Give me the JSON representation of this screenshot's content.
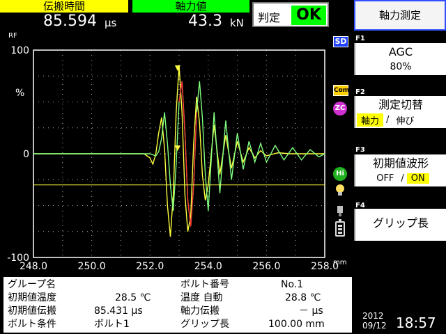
{
  "header": {
    "time_label": "伝搬時間",
    "time_value": "85.594",
    "time_unit": "μs",
    "force_label": "軸力値",
    "force_value": "43.3",
    "force_unit": "kN",
    "judge_label": "判定",
    "judge_value": "OK"
  },
  "chart_data": {
    "type": "line",
    "ylabel": "RF",
    "y_unit": "%",
    "x_unit": "mm",
    "xlim": [
      248.0,
      258.0
    ],
    "ylim": [
      -100,
      100
    ],
    "x_ticks": [
      "248.0",
      "250.0",
      "252.0",
      "254.0",
      "256.0",
      "258.0"
    ],
    "y_ticks": [
      "100",
      "0",
      "-100"
    ],
    "gate_level": -30,
    "marker_x": 252.95,
    "grid": true,
    "colors": {
      "wave_initial": "#ffff40",
      "wave_current": "#80ff80",
      "wave_peak": "#ff3030",
      "gate": "#ffff40",
      "grid": "#b0b0b0"
    },
    "series": [
      {
        "key": "initial",
        "x": [
          248.0,
          251.8,
          252.0,
          252.1,
          252.2,
          252.3,
          252.4,
          252.5,
          252.6,
          252.7,
          252.8,
          252.9,
          253.0,
          253.1,
          253.2,
          253.3,
          253.4,
          253.5,
          253.6,
          253.7,
          253.8,
          253.9,
          254.0,
          254.2,
          254.4,
          254.6,
          254.8,
          255.0,
          255.2,
          255.4,
          255.6,
          255.8,
          256.0,
          256.4,
          256.8,
          257.2,
          257.6,
          258.0
        ],
        "y": [
          0,
          0,
          -4,
          -10,
          0,
          20,
          35,
          5,
          -50,
          -80,
          -40,
          40,
          85,
          40,
          -40,
          -75,
          -60,
          10,
          55,
          30,
          -20,
          -45,
          -30,
          28,
          -20,
          18,
          -14,
          12,
          -8,
          6,
          -4,
          3,
          -2,
          1,
          0,
          0,
          0,
          0
        ]
      },
      {
        "key": "current",
        "x": [
          248.0,
          252.0,
          252.2,
          252.3,
          252.4,
          252.5,
          252.6,
          252.7,
          252.8,
          252.9,
          253.0,
          253.1,
          253.2,
          253.3,
          253.4,
          253.5,
          253.6,
          253.7,
          253.8,
          253.9,
          254.0,
          254.2,
          254.4,
          254.6,
          254.8,
          255.0,
          255.2,
          255.4,
          255.6,
          255.8,
          256.0,
          256.3,
          256.6,
          256.9,
          257.2,
          257.5,
          257.8,
          258.0
        ],
        "y": [
          0,
          0,
          -2,
          2,
          15,
          40,
          10,
          -30,
          -55,
          -10,
          50,
          70,
          20,
          -45,
          -70,
          -30,
          40,
          70,
          35,
          -20,
          -55,
          40,
          -38,
          32,
          -25,
          20,
          -15,
          12,
          -8,
          10,
          -8,
          8,
          -6,
          6,
          -6,
          4,
          -3,
          0
        ]
      }
    ]
  },
  "icons": {
    "sd": "SD",
    "com": "Com",
    "zc": "ZC",
    "hi": "Hi",
    "bulb": "bulb-icon",
    "probe": "probe-icon",
    "battery": "battery-icon"
  },
  "fkeys": {
    "title": "軸力測定",
    "f1": {
      "num": "F1",
      "line1": "AGC",
      "line2": "80%"
    },
    "f2": {
      "num": "F2",
      "line1": "測定切替",
      "opt_a": "軸力",
      "sep": "/",
      "opt_b": "伸び"
    },
    "f3": {
      "num": "F3",
      "line1": "初期値波形",
      "opt_a": "OFF",
      "sep": "/",
      "opt_b": "ON"
    },
    "f4": {
      "num": "F4",
      "line1": "グリップ長"
    }
  },
  "info": {
    "group_label": "グループ名",
    "group_value": "",
    "init_temp_label": "初期値温度",
    "init_temp_value": "28.5 ℃",
    "init_prop_label": "初期値伝搬",
    "init_prop_value": "85.431 μs",
    "bolt_cond_label": "ボルト条件",
    "bolt_cond_value": "ボルト1",
    "bolt_no_label": "ボルト番号",
    "bolt_no_value": "No.1",
    "temp_auto_label": "温度 自動",
    "temp_auto_value": "28.8 ℃",
    "force_prop_label": "軸力伝搬",
    "force_prop_value": "－ μs",
    "grip_label": "グリップ長",
    "grip_value": "100.00 mm"
  },
  "datetime": {
    "year": "2012",
    "month_day": "09/12",
    "time": "18:57"
  }
}
